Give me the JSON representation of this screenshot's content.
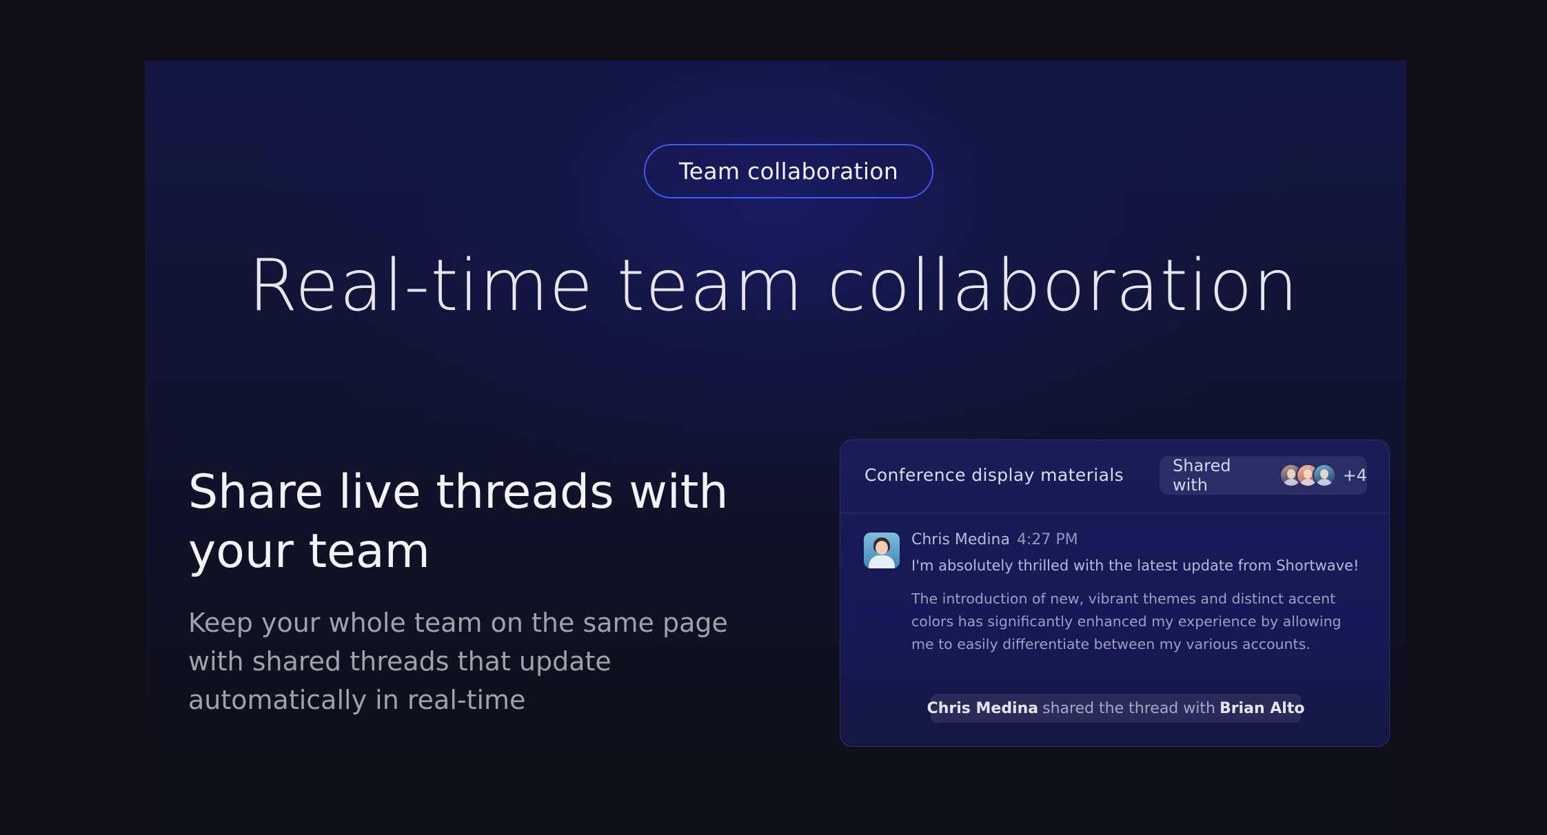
{
  "badge": {
    "label": "Team collaboration"
  },
  "hero": {
    "title": "Real-time team collaboration"
  },
  "feature": {
    "title": "Share live threads with your team",
    "description": "Keep your whole team on the same page with shared threads that update automatically in real-time"
  },
  "card": {
    "title": "Conference display materials",
    "shared": {
      "label": "Shared with",
      "extra_count": "+4"
    },
    "message": {
      "author": "Chris Medina",
      "time": "4:27 PM",
      "line1": "I'm absolutely thrilled with the latest update from Shortwave!",
      "body": "The introduction of new, vibrant themes and distinct accent colors has significantly enhanced my experience by allowing me to easily differentiate between my various accounts."
    },
    "notice": {
      "actor": "Chris Medina",
      "action": "shared the thread with",
      "target": "Brian Alto"
    }
  },
  "colors": {
    "background": "#0f0f15",
    "accent_border": "#3b5bff",
    "card_background": "#1a1c58"
  }
}
